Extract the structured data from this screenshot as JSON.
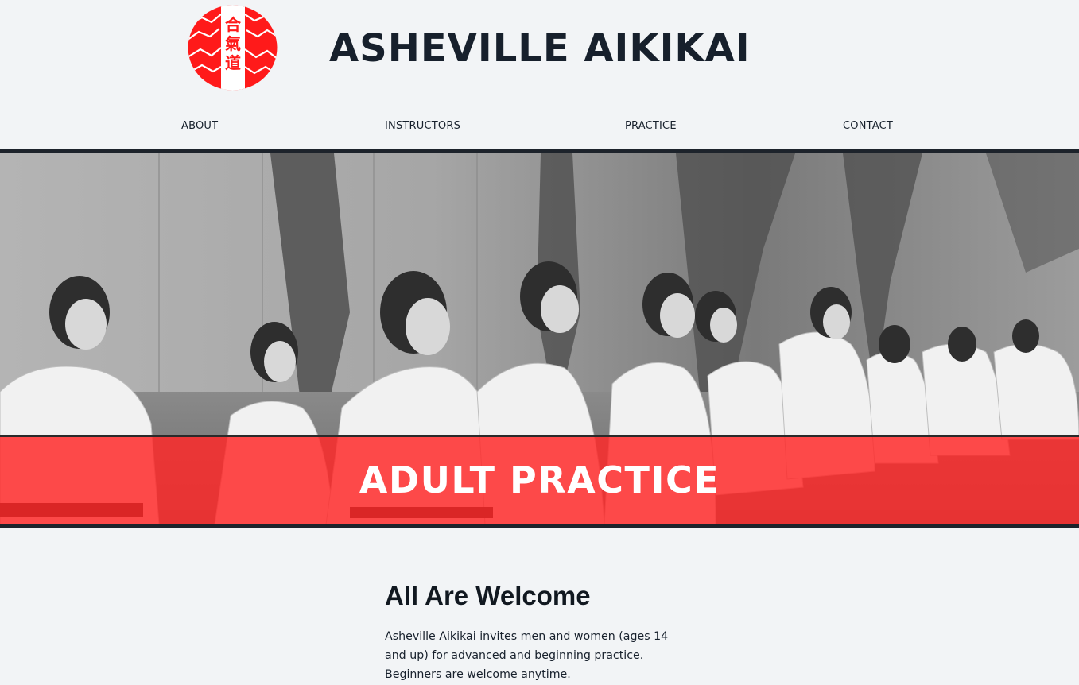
{
  "header": {
    "title": "ASHEVILLE AIKIKAI",
    "logo_text": "合氣道",
    "logo_color": "#ff1a1a"
  },
  "nav": {
    "items": [
      {
        "label": "ABOUT"
      },
      {
        "label": "INSTRUCTORS"
      },
      {
        "label": "PRACTICE"
      },
      {
        "label": "CONTACT"
      }
    ]
  },
  "hero": {
    "banner_title": "ADULT PRACTICE",
    "banner_color": "#ff2828"
  },
  "main": {
    "heading": "All Are Welcome",
    "paragraph": "Asheville Aikikai invites men and women (ages 14 and up) for advanced and beginning practice. Beginners are welcome anytime."
  }
}
